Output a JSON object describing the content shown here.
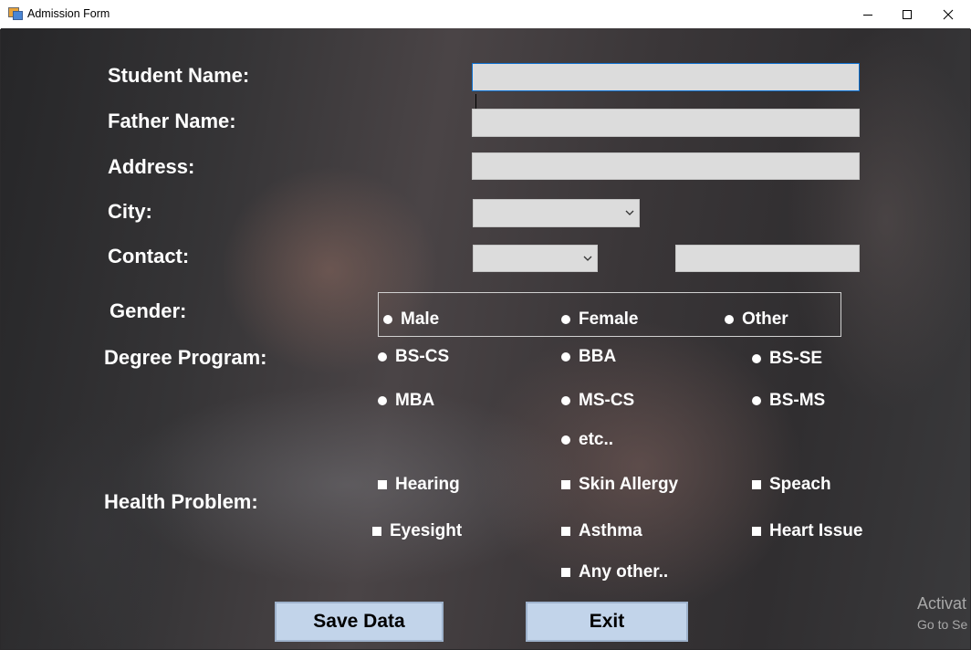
{
  "window": {
    "title": "Admission Form",
    "icon": "winforms-app-icon",
    "controls": [
      "minimize-icon",
      "maximize-icon",
      "close-icon"
    ]
  },
  "form": {
    "labels": {
      "student_name": "Student Name:",
      "father_name": "Father Name:",
      "address": "Address:",
      "city": "City:",
      "contact": "Contact:",
      "gender": "Gender:",
      "degree_program": "Degree Program:",
      "health_problem": "Health Problem:"
    },
    "fields": {
      "student_name": "",
      "father_name": "",
      "address": "",
      "city_selected": "",
      "contact_code_selected": "",
      "contact_number": ""
    },
    "gender_options": [
      "Male",
      "Female",
      "Other"
    ],
    "degree_options": [
      "BS-CS",
      "BBA",
      "BS-SE",
      "MBA",
      "MS-CS",
      "BS-MS",
      "etc.."
    ],
    "health_options": [
      "Hearing",
      "Skin Allergy",
      "Speach",
      "Eyesight",
      "Asthma",
      "Heart Issue",
      "Any other.."
    ],
    "buttons": {
      "save": "Save Data",
      "exit": "Exit"
    }
  },
  "watermark": {
    "line1": "Activat",
    "line2": "Go to Se"
  },
  "colors": {
    "field_bg": "#dcdcdc",
    "button_bg": "#c2d4ea",
    "label_text": "#ffffff",
    "focus_border": "#0b6fd0"
  }
}
